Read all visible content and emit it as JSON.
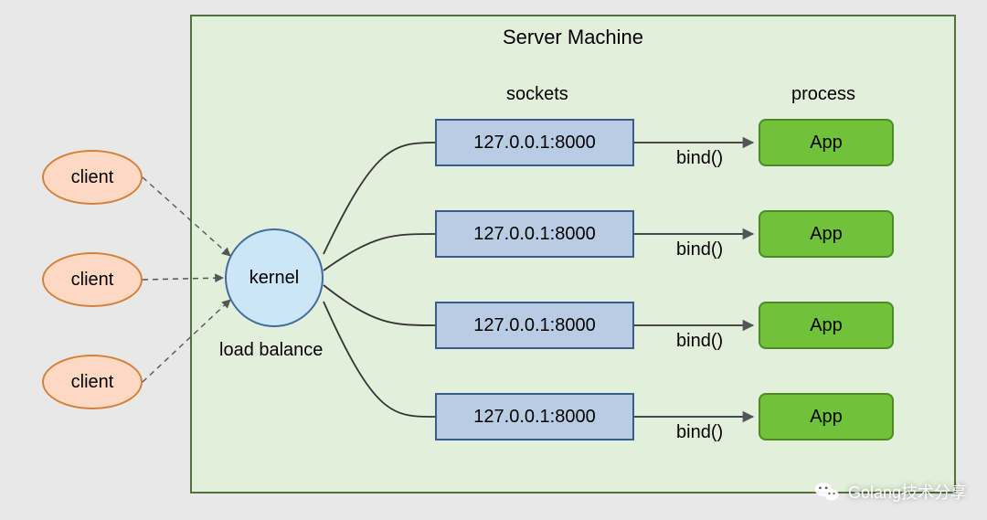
{
  "server_title": "Server Machine",
  "clients": [
    "client",
    "client",
    "client"
  ],
  "kernel_label": "kernel",
  "load_balance_label": "load balance",
  "columns": {
    "sockets": "sockets",
    "process": "process"
  },
  "rows": [
    {
      "socket": "127.0.0.1:8000",
      "bind": "bind()",
      "app": "App"
    },
    {
      "socket": "127.0.0.1:8000",
      "bind": "bind()",
      "app": "App"
    },
    {
      "socket": "127.0.0.1:8000",
      "bind": "bind()",
      "app": "App"
    },
    {
      "socket": "127.0.0.1:8000",
      "bind": "bind()",
      "app": "App"
    }
  ],
  "watermark": "Golang技术分享"
}
